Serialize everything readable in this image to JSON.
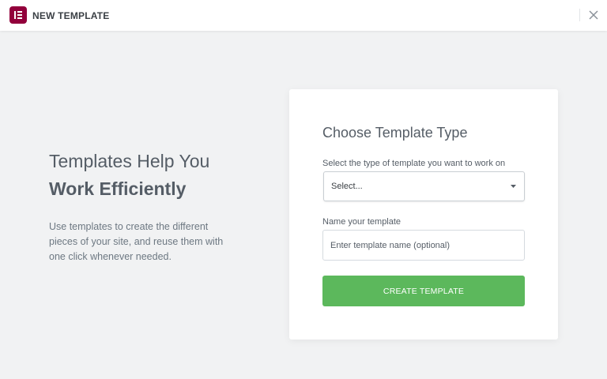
{
  "header": {
    "title": "NEW TEMPLATE",
    "logo_icon": "elementor-logo-icon",
    "close_icon": "close-icon",
    "logo_color": "#92003b"
  },
  "promo": {
    "title_line1": "Templates Help You",
    "title_line2": "Work Efficiently",
    "description": "Use templates to create the different pieces of your site, and reuse them with one click whenever needed."
  },
  "form": {
    "title": "Choose Template Type",
    "type_label": "Select the type of template you want to work on",
    "type_selected": "Select...",
    "name_label": "Name your template",
    "name_value": "",
    "name_placeholder": "Enter template name (optional)",
    "submit_label": "CREATE TEMPLATE",
    "submit_color": "#5cb85c"
  }
}
